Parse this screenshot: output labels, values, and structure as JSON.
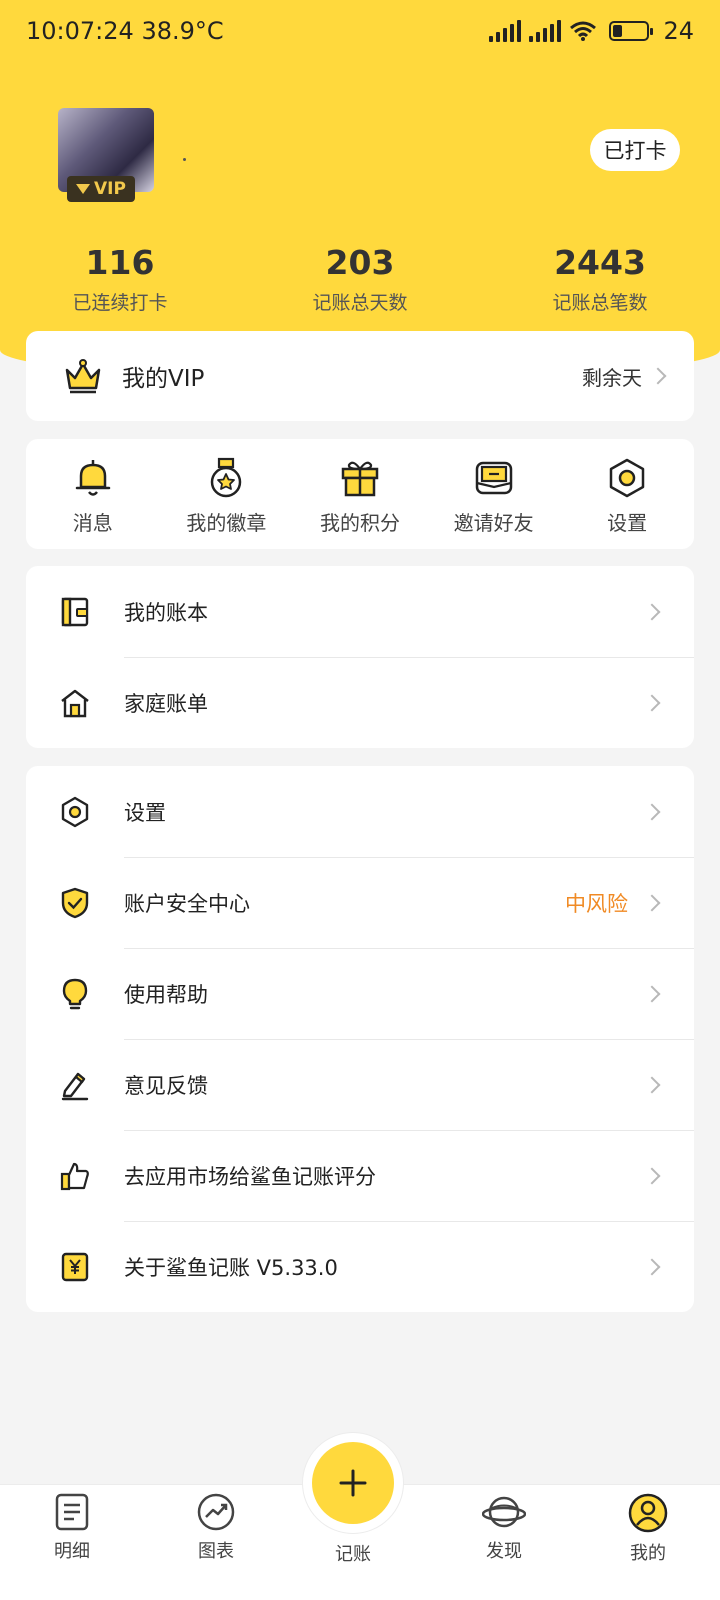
{
  "status_bar": {
    "time": "10:07:24",
    "temperature": "38.9°C",
    "battery": "24"
  },
  "profile": {
    "vip_badge": "VIP",
    "checkin_label": "已打卡"
  },
  "stats": [
    {
      "value": "116",
      "label": "已连续打卡"
    },
    {
      "value": "203",
      "label": "记账总天数"
    },
    {
      "value": "2443",
      "label": "记账总笔数"
    }
  ],
  "vip_card": {
    "label": "我的VIP",
    "remaining": "剩余天"
  },
  "quick_actions": [
    {
      "label": "消息",
      "icon": "bell-icon"
    },
    {
      "label": "我的徽章",
      "icon": "medal-icon"
    },
    {
      "label": "我的积分",
      "icon": "gift-icon"
    },
    {
      "label": "邀请好友",
      "icon": "envelope-icon"
    },
    {
      "label": "设置",
      "icon": "hexagon-settings-icon"
    }
  ],
  "book_list": [
    {
      "label": "我的账本",
      "icon": "ledger-icon"
    },
    {
      "label": "家庭账单",
      "icon": "house-icon"
    }
  ],
  "settings_list": [
    {
      "label": "设置",
      "icon": "hexagon-settings-icon"
    },
    {
      "label": "账户安全中心",
      "icon": "shield-icon",
      "tail": "中风险"
    },
    {
      "label": "使用帮助",
      "icon": "lightbulb-icon"
    },
    {
      "label": "意见反馈",
      "icon": "pencil-icon"
    },
    {
      "label": "去应用市场给鲨鱼记账评分",
      "icon": "thumbs-up-icon"
    },
    {
      "label": "关于鲨鱼记账 V5.33.0",
      "icon": "yuan-card-icon"
    }
  ],
  "tabbar": {
    "tabs": [
      {
        "label": "明细",
        "icon": "document-icon"
      },
      {
        "label": "图表",
        "icon": "chart-icon"
      },
      {
        "label": "发现",
        "icon": "planet-icon"
      },
      {
        "label": "我的",
        "icon": "profile-icon"
      }
    ],
    "fab_label": "记账"
  },
  "colors": {
    "accent": "#ffd93d",
    "risk": "#f08a24",
    "background": "#f4f4f4"
  }
}
